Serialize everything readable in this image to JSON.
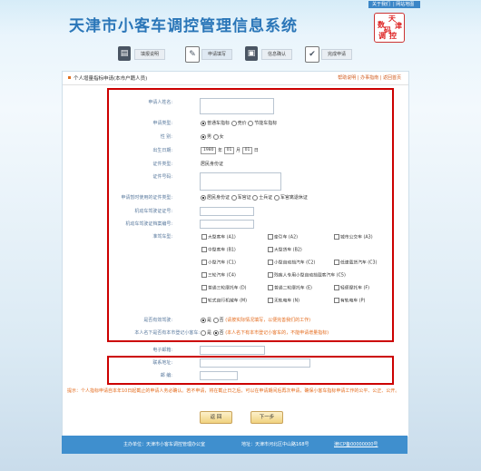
{
  "header": {
    "title": "天津市小客车调控管理信息系统",
    "links": [
      "关于我们",
      "网站地图"
    ],
    "logo_chars": [
      "天",
      "津",
      "数",
      "码",
      "调",
      "控"
    ]
  },
  "steps": [
    {
      "label": "填报说明",
      "icon": "document-icon"
    },
    {
      "label": "申请填写",
      "icon": "edit-icon"
    },
    {
      "label": "信息确认",
      "icon": "save-icon"
    },
    {
      "label": "完成申请",
      "icon": "check-icon"
    }
  ],
  "panel": {
    "title": "个人增量指标申请(本市户籍人员)",
    "links": "帮助说明 | 办事指南 | 返回首页"
  },
  "form": {
    "applicant_label": "申请人姓名:",
    "type_label": "申请类型:",
    "type_options": [
      "普通车指标",
      "竞价",
      "节能车指标"
    ],
    "gender_label": "性    别:",
    "gender_options": [
      "男",
      "女"
    ],
    "birth_label": "出生日期:",
    "birth_year": "1980",
    "birth_year_unit": "年",
    "birth_month": "01",
    "birth_month_unit": "月",
    "birth_day": "01",
    "birth_day_unit": "日",
    "id_type_label": "证件类型:",
    "id_type_value": "居民身份证",
    "id_number_label": "证件号码:",
    "temp_id_label": "申请暂时使用的证件类型:",
    "temp_id_options": [
      "居民身份证",
      "军官证",
      "士兵证",
      "军官离退休证"
    ],
    "license_label": "机动车驾驶证证号:",
    "license_file_label": "机动车驾驶证档案编号:",
    "car_type_label": "准驾车型:",
    "car_types": [
      "大型客车 (A1)",
      "牵引车 (A2)",
      "城市公交车 (A3)",
      "中型客车 (B1)",
      "大型货车 (B2)",
      "",
      "小型汽车 (C1)",
      "小型自动挡汽车 (C2)",
      "低速载货汽车 (C3)",
      "三轮汽车 (C4)",
      "残疾人专用小型自动挡载客汽车 (C5)",
      "",
      "普通三轮摩托车 (D)",
      "普通二轮摩托车 (E)",
      "轻便摩托车 (F)",
      "轮式自行机械车 (M)",
      "无轨电车 (N)",
      "有轨电车 (P)"
    ],
    "owns_car_label": "是否有效驾驶:",
    "owns_car_options": [
      "是",
      "否"
    ],
    "owns_car_note": "(请按实际情况填写，以便完善我们的工作)",
    "registered_label": "本人名下是否有本市登记小客车:",
    "registered_options": [
      "是",
      "否"
    ],
    "registered_note": "(本人名下有本市登记小客车的，不能申请增量指标)",
    "email_label": "电子邮箱:",
    "address_label": "联系地址:",
    "postcode_label": "邮    编:"
  },
  "notice": "提示：个人指标申请自本年10日起截止的申请人务必确认。若不申请，将在截止日之后，可以在申请期间后再次申请，确保小客车指标申请工作的公平、公正、公开。",
  "buttons": {
    "back": "返 回",
    "next": "下一步"
  },
  "footer": {
    "sponsor": "主办单位：天津市小客车调控管理办公室",
    "address": "地址：天津市河北区中山路168号",
    "icp": "津ICP备00000000号"
  }
}
